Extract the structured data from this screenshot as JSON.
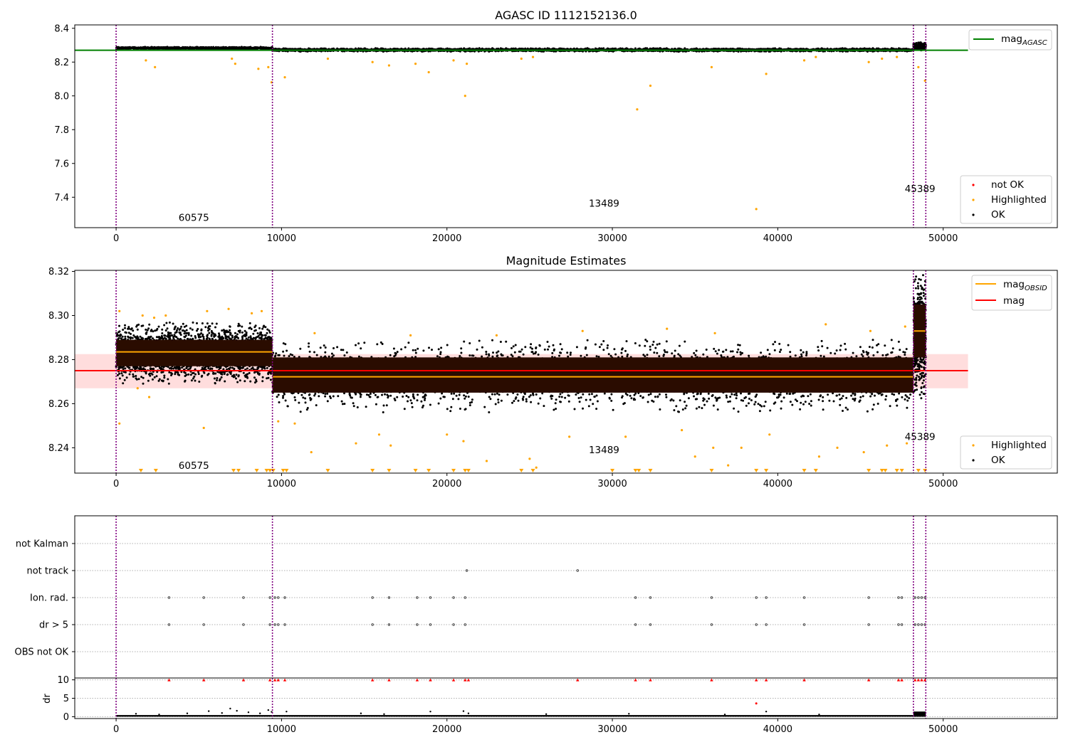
{
  "figure": {
    "background": "#ffffff"
  },
  "colors": {
    "ok": "#000000",
    "highlighted": "#ffa500",
    "not_ok": "#ff0000",
    "mag_agasc": "#008000",
    "mag_obsid": "#ffa500",
    "mag": "#ff0000",
    "mag_band": "#ffdddd",
    "obs_boundary": "#800080",
    "grid": "#b0b0b0"
  },
  "chart_data": [
    {
      "id": "panel1",
      "type": "scatter",
      "title": "AGASC ID 1112152136.0",
      "xlabel": "",
      "ylabel": "",
      "xlim": [
        -2500,
        56900
      ],
      "ylim": [
        7.22,
        8.42
      ],
      "x_ticks": [
        0,
        10000,
        20000,
        30000,
        40000,
        50000
      ],
      "x_tick_labels": [
        "0",
        "10000",
        "20000",
        "30000",
        "40000",
        "50000"
      ],
      "y_ticks": [
        7.4,
        7.6,
        7.8,
        8.0,
        8.2,
        8.4
      ],
      "y_tick_labels": [
        "7.4",
        "7.6",
        "7.8",
        "8.0",
        "8.2",
        "8.4"
      ],
      "grid": false,
      "obs_boundaries": [
        0,
        9450,
        48200,
        48950
      ],
      "obsid_labels": [
        {
          "text": "60575",
          "x": 4700,
          "y": 7.26
        },
        {
          "text": "13489",
          "x": 29500,
          "y": 7.345
        },
        {
          "text": "45389",
          "x": 48600,
          "y": 7.43
        }
      ],
      "lines": [
        {
          "name": "mag_AGASC",
          "y": 8.27,
          "x": [
            -2500,
            51500
          ],
          "color": "#008000"
        }
      ],
      "legend_lines": [
        {
          "label": "mag",
          "sub": "AGASC",
          "color": "#008000",
          "placement": "top-right"
        }
      ],
      "legend_points": [
        {
          "label": "not OK",
          "color": "#ff0000",
          "placement": "bottom-right"
        },
        {
          "label": "Highlighted",
          "color": "#ffa500",
          "placement": "bottom-right"
        },
        {
          "label": "OK",
          "color": "#000000",
          "placement": "bottom-right"
        }
      ],
      "highlighted_points": [
        [
          1800,
          8.21
        ],
        [
          2350,
          8.17
        ],
        [
          7000,
          8.22
        ],
        [
          7200,
          8.19
        ],
        [
          8600,
          8.16
        ],
        [
          9200,
          8.17
        ],
        [
          9400,
          8.08
        ],
        [
          10200,
          8.11
        ],
        [
          12800,
          8.22
        ],
        [
          15500,
          8.2
        ],
        [
          16500,
          8.18
        ],
        [
          18100,
          8.19
        ],
        [
          18900,
          8.14
        ],
        [
          20400,
          8.21
        ],
        [
          21100,
          8.0
        ],
        [
          21200,
          8.19
        ],
        [
          24500,
          8.22
        ],
        [
          25200,
          8.23
        ],
        [
          31500,
          7.92
        ],
        [
          32300,
          8.06
        ],
        [
          36000,
          8.17
        ],
        [
          38700,
          7.33
        ],
        [
          39300,
          8.13
        ],
        [
          41600,
          8.21
        ],
        [
          42300,
          8.23
        ],
        [
          45500,
          8.2
        ],
        [
          46300,
          8.22
        ],
        [
          47200,
          8.23
        ],
        [
          48500,
          8.17
        ],
        [
          48900,
          8.09
        ]
      ],
      "ok_bands": [
        {
          "x": [
            0,
            9450
          ],
          "y": [
            8.275,
            8.29
          ]
        },
        {
          "x": [
            9450,
            48200
          ],
          "y": [
            8.262,
            8.282
          ]
        },
        {
          "x": [
            48200,
            48950
          ],
          "y": [
            8.268,
            8.318
          ]
        }
      ]
    },
    {
      "id": "panel2",
      "type": "scatter",
      "title": "Magnitude Estimates",
      "xlabel": "",
      "ylabel": "",
      "xlim": [
        -2500,
        56900
      ],
      "ylim": [
        8.2285,
        8.3205
      ],
      "x_ticks": [
        0,
        10000,
        20000,
        30000,
        40000,
        50000
      ],
      "x_tick_labels": [
        "0",
        "10000",
        "20000",
        "30000",
        "40000",
        "50000"
      ],
      "y_ticks": [
        8.24,
        8.26,
        8.28,
        8.3,
        8.32
      ],
      "y_tick_labels": [
        "8.24",
        "8.26",
        "8.28",
        "8.30",
        "8.32"
      ],
      "grid": false,
      "obs_boundaries": [
        0,
        9450,
        48200,
        48950
      ],
      "obsid_labels": [
        {
          "text": "60575",
          "x": 4700,
          "y": 8.2305
        },
        {
          "text": "13489",
          "x": 29500,
          "y": 8.2375
        },
        {
          "text": "45389",
          "x": 48600,
          "y": 8.2435
        }
      ],
      "mag_band": {
        "y": [
          8.267,
          8.2825
        ],
        "x": [
          -2500,
          51500
        ]
      },
      "lines": [
        {
          "name": "mag",
          "y": 8.275,
          "x": [
            -2500,
            51500
          ],
          "color": "#ff0000"
        },
        {
          "name": "mag_OBSID_60575",
          "y": 8.2835,
          "x": [
            0,
            9450
          ],
          "color": "#ffa500"
        },
        {
          "name": "mag_OBSID_13489",
          "y": 8.2722,
          "x": [
            9450,
            48200
          ],
          "color": "#ffa500"
        },
        {
          "name": "mag_OBSID_45389",
          "y": 8.293,
          "x": [
            48200,
            48950
          ],
          "color": "#ffa500"
        }
      ],
      "legend_lines": [
        {
          "label": "mag",
          "sub": "OBSID",
          "color": "#ffa500",
          "placement": "top-right"
        },
        {
          "label": "mag",
          "sub": "",
          "color": "#ff0000",
          "placement": "top-right"
        }
      ],
      "legend_points": [
        {
          "label": "Highlighted",
          "color": "#ffa500",
          "placement": "bottom-right"
        },
        {
          "label": "OK",
          "color": "#000000",
          "placement": "bottom-right"
        }
      ],
      "ok_bands": [
        {
          "x": [
            0,
            9450
          ],
          "y": [
            8.269,
            8.297
          ],
          "core": [
            8.277,
            8.289
          ]
        },
        {
          "x": [
            9450,
            48200
          ],
          "y": [
            8.256,
            8.289
          ],
          "core": [
            8.265,
            8.281
          ]
        },
        {
          "x": [
            48200,
            48950
          ],
          "y": [
            8.262,
            8.32
          ],
          "core": [
            8.281,
            8.305
          ]
        }
      ],
      "highlighted_points": [
        [
          200,
          8.302
        ],
        [
          1600,
          8.3
        ],
        [
          2300,
          8.299
        ],
        [
          3000,
          8.3
        ],
        [
          5500,
          8.302
        ],
        [
          6800,
          8.303
        ],
        [
          8200,
          8.301
        ],
        [
          8800,
          8.302
        ],
        [
          1300,
          8.267
        ],
        [
          2000,
          8.263
        ],
        [
          5300,
          8.249
        ],
        [
          9800,
          8.252
        ],
        [
          10800,
          8.251
        ],
        [
          11800,
          8.238
        ],
        [
          14500,
          8.242
        ],
        [
          15900,
          8.246
        ],
        [
          16600,
          8.241
        ],
        [
          20000,
          8.246
        ],
        [
          21000,
          8.243
        ],
        [
          22400,
          8.234
        ],
        [
          25000,
          8.235
        ],
        [
          25400,
          8.231
        ],
        [
          27400,
          8.245
        ],
        [
          30800,
          8.245
        ],
        [
          34200,
          8.248
        ],
        [
          35000,
          8.236
        ],
        [
          36100,
          8.24
        ],
        [
          37000,
          8.232
        ],
        [
          37800,
          8.24
        ],
        [
          39500,
          8.246
        ],
        [
          42500,
          8.236
        ],
        [
          43600,
          8.24
        ],
        [
          45200,
          8.238
        ],
        [
          46600,
          8.241
        ],
        [
          47800,
          8.242
        ],
        [
          12000,
          8.292
        ],
        [
          17800,
          8.291
        ],
        [
          23000,
          8.291
        ],
        [
          28200,
          8.293
        ],
        [
          33300,
          8.294
        ],
        [
          36200,
          8.292
        ],
        [
          42900,
          8.296
        ],
        [
          45600,
          8.293
        ],
        [
          47700,
          8.295
        ],
        [
          200,
          8.251
        ]
      ],
      "clipped_markers_x": [
        1500,
        2400,
        7100,
        7400,
        8500,
        9100,
        9300,
        9500,
        10100,
        10300,
        12800,
        15500,
        16500,
        18100,
        18900,
        20400,
        21100,
        21300,
        24500,
        25200,
        30000,
        31400,
        31600,
        32300,
        36000,
        38700,
        39300,
        41600,
        42300,
        45500,
        46300,
        46500,
        47200,
        47500,
        48500,
        48900
      ]
    },
    {
      "id": "panel3",
      "type": "scatter",
      "title": "",
      "xlabel": "",
      "ylabel": "",
      "xlim": [
        -2500,
        56900
      ],
      "categories": [
        "not Kalman",
        "not track",
        "Ion. rad.",
        "dr > 5",
        "OBS not OK"
      ],
      "grid": true,
      "obs_boundaries": [
        0,
        9450,
        48200,
        48950
      ],
      "flag_points": {
        "not track": [
          21200,
          27900
        ],
        "Ion. rad.": [
          3200,
          5300,
          7700,
          9300,
          9600,
          9800,
          10200,
          15500,
          16500,
          18200,
          19000,
          20400,
          21100,
          31400,
          32300,
          36000,
          38700,
          39300,
          41600,
          45500,
          47300,
          47500,
          48300,
          48500,
          48700,
          48900
        ],
        "dr > 5": [
          3200,
          5300,
          7700,
          9300,
          9600,
          9800,
          10200,
          15500,
          16500,
          18200,
          19000,
          20400,
          21100,
          31400,
          32300,
          36000,
          38700,
          39300,
          41600,
          45500,
          47300,
          47500,
          48300,
          48500,
          48700,
          48900
        ]
      }
    },
    {
      "id": "panel4",
      "type": "scatter",
      "title": "",
      "xlabel": "",
      "ylabel": "dr",
      "xlim": [
        -2500,
        56900
      ],
      "ylim": [
        -0.5,
        10.5
      ],
      "x_ticks": [
        0,
        10000,
        20000,
        30000,
        40000,
        50000
      ],
      "x_tick_labels": [
        "0",
        "10000",
        "20000",
        "30000",
        "40000",
        "50000"
      ],
      "y_ticks": [
        0,
        5,
        10
      ],
      "y_tick_labels": [
        "0",
        "5",
        "10"
      ],
      "grid": true,
      "obs_boundaries": [
        0,
        9450,
        48200,
        48950
      ],
      "red_triangles_x": [
        3200,
        5300,
        7700,
        9300,
        9600,
        9800,
        10200,
        15500,
        16500,
        18200,
        19000,
        20400,
        21100,
        21300,
        27900,
        31400,
        32300,
        36000,
        38700,
        39300,
        41600,
        45500,
        47300,
        47500,
        48300,
        48500,
        48700,
        48900
      ],
      "red_points": [
        [
          38700,
          3.6
        ]
      ],
      "dr_points": [
        [
          1200,
          0.8
        ],
        [
          2600,
          0.6
        ],
        [
          4300,
          0.9
        ],
        [
          5600,
          1.5
        ],
        [
          6400,
          1.0
        ],
        [
          6900,
          2.2
        ],
        [
          7300,
          1.6
        ],
        [
          8000,
          1.2
        ],
        [
          8700,
          0.9
        ],
        [
          9200,
          1.8
        ],
        [
          9400,
          1.3
        ],
        [
          10300,
          1.4
        ],
        [
          14800,
          0.9
        ],
        [
          16200,
          0.7
        ],
        [
          19000,
          1.4
        ],
        [
          21000,
          1.5
        ],
        [
          21300,
          0.9
        ],
        [
          26000,
          0.7
        ],
        [
          31000,
          0.8
        ],
        [
          36800,
          0.6
        ],
        [
          39300,
          1.4
        ],
        [
          42500,
          0.6
        ]
      ],
      "dr_band": {
        "x": [
          0,
          48950
        ],
        "y": [
          0,
          0.45
        ]
      },
      "dr_band_last": {
        "x": [
          48200,
          48950
        ],
        "y": [
          0,
          1.4
        ]
      }
    }
  ]
}
